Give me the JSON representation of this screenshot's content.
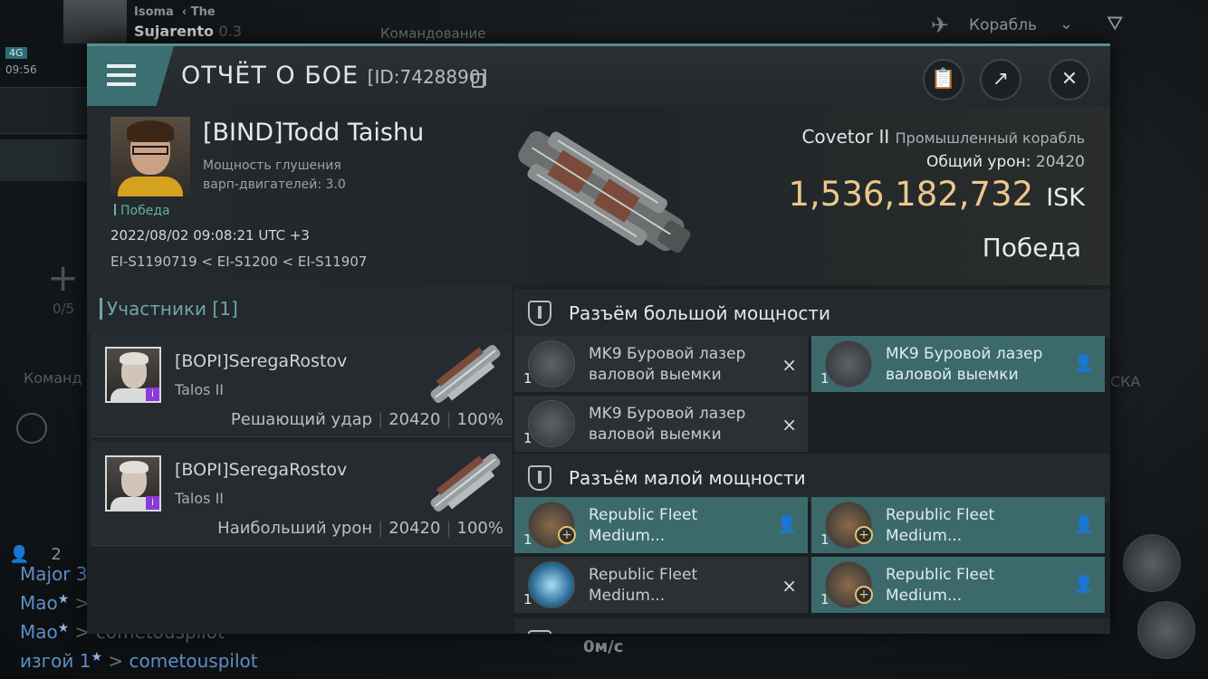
{
  "background": {
    "pilot_name_top": "Isoma",
    "pilot_tag": "The",
    "pilot_name": "Sujarento",
    "pilot_suffix": "0.3",
    "network": "4G",
    "time": "09:56",
    "command_label": "Командование",
    "ship_label": "Корабль",
    "side_count": "0/5",
    "side_command": "Команд",
    "side_right": "СКА",
    "user_count": "2",
    "speed": "0м/с",
    "chat": [
      {
        "name": "Major 3",
        "text": ""
      },
      {
        "name": "Mao",
        "text": ""
      },
      {
        "name": "Mao",
        "text": "cometouspilot"
      },
      {
        "name": "изгой 1",
        "text": "cometouspilot"
      }
    ]
  },
  "dialog": {
    "title": "ОТЧЁТ О БОЕ",
    "report_id": "[ID:7428890]"
  },
  "victim": {
    "name": "[BIND]Todd Taishu",
    "info_line1": "Мощность глушения",
    "info_line2": "варп-двигателей: 3.0",
    "status_tag": "Победа",
    "datetime": "2022/08/02 09:08:21 UTC +3",
    "route": "EI-S1190719 < EI-S1200 < EI-S11907",
    "ship_name": "Covetor II",
    "ship_class": "Промышленный корабль",
    "damage_label": "Общий урон:",
    "damage_value": "20420",
    "isk_value": "1,536,182,732",
    "isk_unit": "ISK",
    "result": "Победа"
  },
  "participants": {
    "header": "Участники [1]",
    "rows": [
      {
        "name": "[BOPI]SeregaRostov",
        "ship": "Talos II",
        "role": "Решающий удар",
        "damage": "20420",
        "percent": "100%"
      },
      {
        "name": "[BOPI]SeregaRostov",
        "ship": "Talos II",
        "role": "Наибольший урон",
        "damage": "20420",
        "percent": "100%"
      }
    ]
  },
  "fittings": {
    "high_label": "Разъём большой мощности",
    "low_label": "Разъём малой мощности",
    "high": [
      {
        "qty": "1",
        "name": "MK9 Буровой лазер валовой выемки",
        "state": "×"
      },
      {
        "qty": "1",
        "name": "MK9 Буровой лазер валовой выемки",
        "state": "👤"
      },
      {
        "qty": "1",
        "name": "MK9 Буровой лазер валовой выемки",
        "state": "×"
      }
    ],
    "low": [
      {
        "qty": "1",
        "name": "Republic Fleet Medium...",
        "state": "👤"
      },
      {
        "qty": "1",
        "name": "Republic Fleet Medium...",
        "state": "👤"
      },
      {
        "qty": "1",
        "name": "Republic Fleet Medium...",
        "state": "×"
      },
      {
        "qty": "1",
        "name": "Republic Fleet Medium...",
        "state": "👤"
      }
    ]
  }
}
